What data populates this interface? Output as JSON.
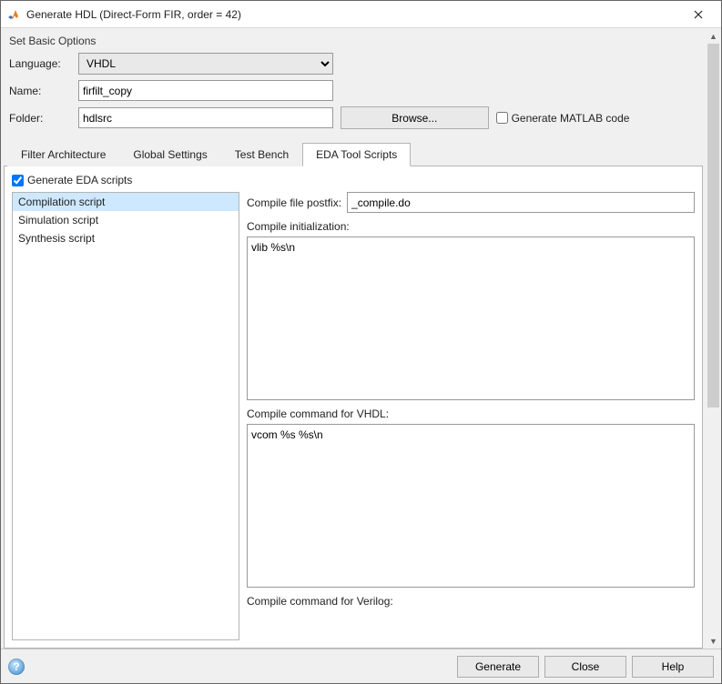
{
  "window": {
    "title": "Generate HDL (Direct-Form FIR, order = 42)"
  },
  "basic": {
    "group_title": "Set Basic Options",
    "language_label": "Language:",
    "language_value": "VHDL",
    "name_label": "Name:",
    "name_value": "firfilt_copy",
    "folder_label": "Folder:",
    "folder_value": "hdlsrc",
    "browse_label": "Browse...",
    "gen_matlab_label": "Generate MATLAB code",
    "gen_matlab_checked": false
  },
  "tabs": [
    {
      "label": "Filter Architecture",
      "active": false
    },
    {
      "label": "Global Settings",
      "active": false
    },
    {
      "label": "Test Bench",
      "active": false
    },
    {
      "label": "EDA Tool Scripts",
      "active": true
    }
  ],
  "eda": {
    "generate_label": "Generate EDA scripts",
    "generate_checked": true,
    "scripts": [
      {
        "label": "Compilation script",
        "selected": true
      },
      {
        "label": "Simulation script",
        "selected": false
      },
      {
        "label": "Synthesis script",
        "selected": false
      }
    ],
    "compile_postfix_label": "Compile file postfix:",
    "compile_postfix_value": "_compile.do",
    "compile_init_label": "Compile initialization:",
    "compile_init_value": "vlib %s\\n",
    "compile_vhdl_label": "Compile command for VHDL:",
    "compile_vhdl_value": "vcom %s %s\\n",
    "compile_verilog_label": "Compile command for Verilog:"
  },
  "footer": {
    "generate_label": "Generate",
    "close_label": "Close",
    "help_label": "Help"
  }
}
